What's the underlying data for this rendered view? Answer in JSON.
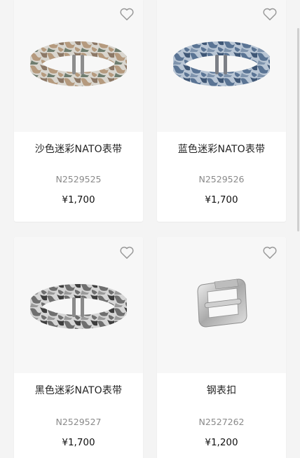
{
  "products": [
    {
      "name": "沙色迷彩NATO表带",
      "sku": "N2529525",
      "price": "¥1,700",
      "icon": "heart-outline-icon",
      "strap_colors": [
        "#b59a7e",
        "#8c7866",
        "#d9d6cf",
        "#6f7d6f"
      ]
    },
    {
      "name": "蓝色迷彩NATO表带",
      "sku": "N2529526",
      "price": "¥1,700",
      "icon": "heart-outline-icon",
      "strap_colors": [
        "#5a7494",
        "#3f5776",
        "#b9c6d5",
        "#7f94ad"
      ]
    },
    {
      "name": "黑色迷彩NATO表带",
      "sku": "N2529527",
      "price": "¥1,700",
      "icon": "heart-outline-icon",
      "strap_colors": [
        "#6f6f6f",
        "#3e3e3e",
        "#d6d6d6",
        "#9a9a9a"
      ]
    },
    {
      "name": "钢表扣",
      "sku": "N2527262",
      "price": "¥1,200",
      "icon": "heart-outline-icon"
    }
  ],
  "colors": {
    "page_bg": "#f4f4f4",
    "card_bg": "#ffffff",
    "image_bg": "#f7f7f7",
    "sku_text": "#8a8a8a",
    "name_text": "#222222"
  }
}
